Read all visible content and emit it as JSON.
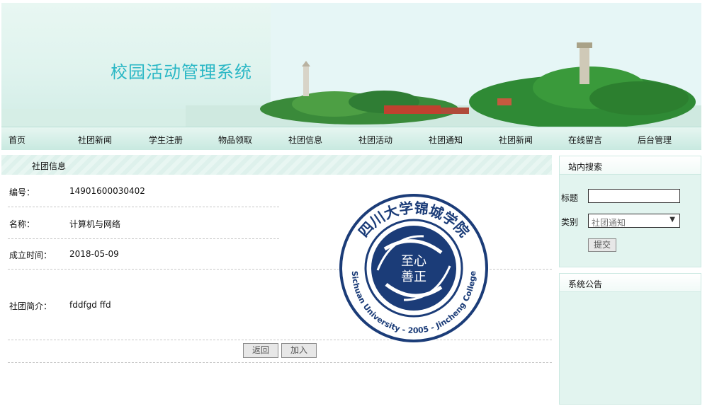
{
  "site": {
    "title": "校园活动管理系统"
  },
  "nav": [
    {
      "label": "首页"
    },
    {
      "label": "社团新闻"
    },
    {
      "label": "学生注册"
    },
    {
      "label": "物品领取"
    },
    {
      "label": "社团信息"
    },
    {
      "label": "社团活动"
    },
    {
      "label": "社团通知"
    },
    {
      "label": "社团新闻"
    },
    {
      "label": "在线留言"
    },
    {
      "label": "后台管理"
    }
  ],
  "main": {
    "header": "社团信息",
    "fields": {
      "id": {
        "label": "编号：",
        "value": "14901600030402"
      },
      "name": {
        "label": "名称：",
        "value": "计算机与网络"
      },
      "founded": {
        "label": "成立时间：",
        "value": "2018-05-09"
      },
      "intro": {
        "label": "社团简介：",
        "value": "fddfgd ffd"
      }
    },
    "buttons": {
      "back": "返回",
      "join": "加入"
    },
    "logo": {
      "ring_text_cn": "四川大学锦城学院",
      "ring_text_en": "Sichuan University - 2005 - Jincheng College",
      "center_text_top": "至心",
      "center_text_bottom": "善正",
      "color": "#1b3c78"
    }
  },
  "sidebar": {
    "search": {
      "header": "站内搜索",
      "title_label": "标题",
      "title_value": "",
      "category_label": "类别",
      "category_value": "社团通知",
      "submit": "提交"
    },
    "notice": {
      "header": "系统公告"
    }
  },
  "colors": {
    "title": "#29b7c5",
    "nav_bg": "#c8e9e0",
    "sidebar_bg": "#e2f4ef",
    "logo": "#1b3c78"
  }
}
